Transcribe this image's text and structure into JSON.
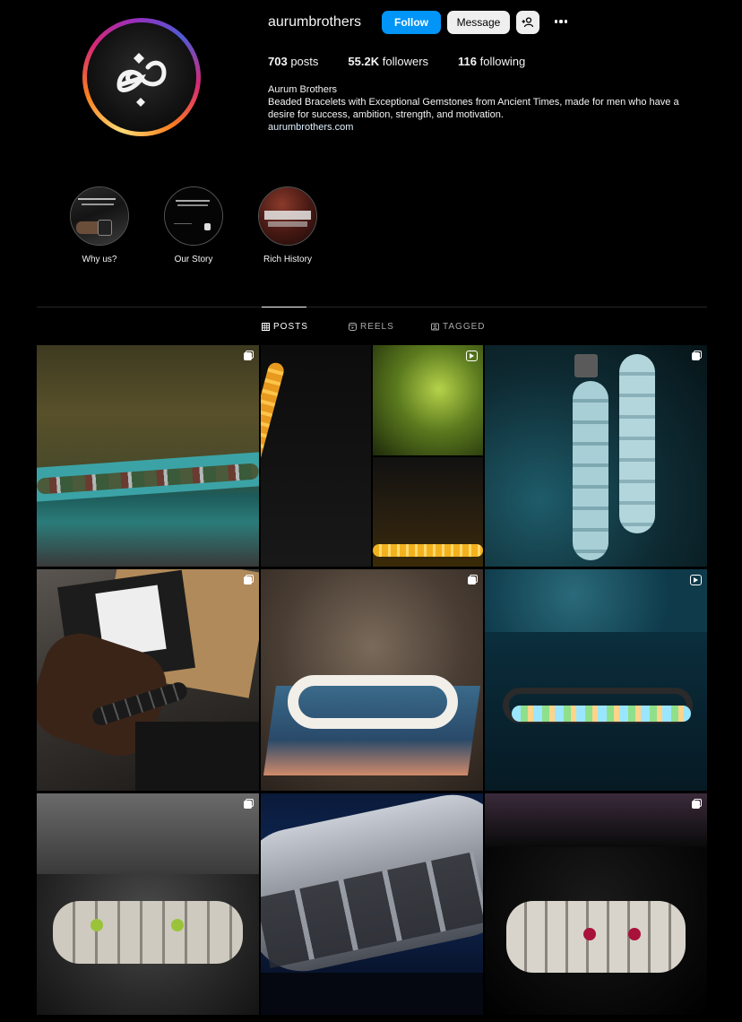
{
  "profile": {
    "username": "aurumbrothers",
    "follow_label": "Follow",
    "message_label": "Message",
    "stats": {
      "posts": "703",
      "posts_label": "posts",
      "followers": "55.2K",
      "followers_label": "followers",
      "following": "116",
      "following_label": "following"
    },
    "bio": {
      "name": "Aurum Brothers",
      "text": "Beaded Bracelets with Exceptional Gemstones from Ancient Times, made for men who have a desire for success, ambition, strength, and motivation.",
      "link": "aurumbrothers.com"
    },
    "logo_text": "ab"
  },
  "highlights": [
    {
      "label": "Why us?"
    },
    {
      "label": "Our Story"
    },
    {
      "label": "Rich History"
    }
  ],
  "tabs": [
    {
      "label": "POSTS",
      "icon": "grid-icon",
      "active": true
    },
    {
      "label": "REELS",
      "icon": "reels-icon",
      "active": false
    },
    {
      "label": "TAGGED",
      "icon": "tagged-icon",
      "active": false
    }
  ],
  "posts": [
    {
      "type": "multi"
    },
    {
      "type": "reel"
    },
    {
      "type": "multi"
    },
    {
      "type": "multi"
    },
    {
      "type": "multi"
    },
    {
      "type": "reel"
    },
    {
      "type": "multi"
    },
    {
      "type": "multi"
    },
    {
      "type": "multi"
    }
  ],
  "colors": {
    "accent": "#0095f6",
    "background": "#000000",
    "divider": "#262626"
  }
}
